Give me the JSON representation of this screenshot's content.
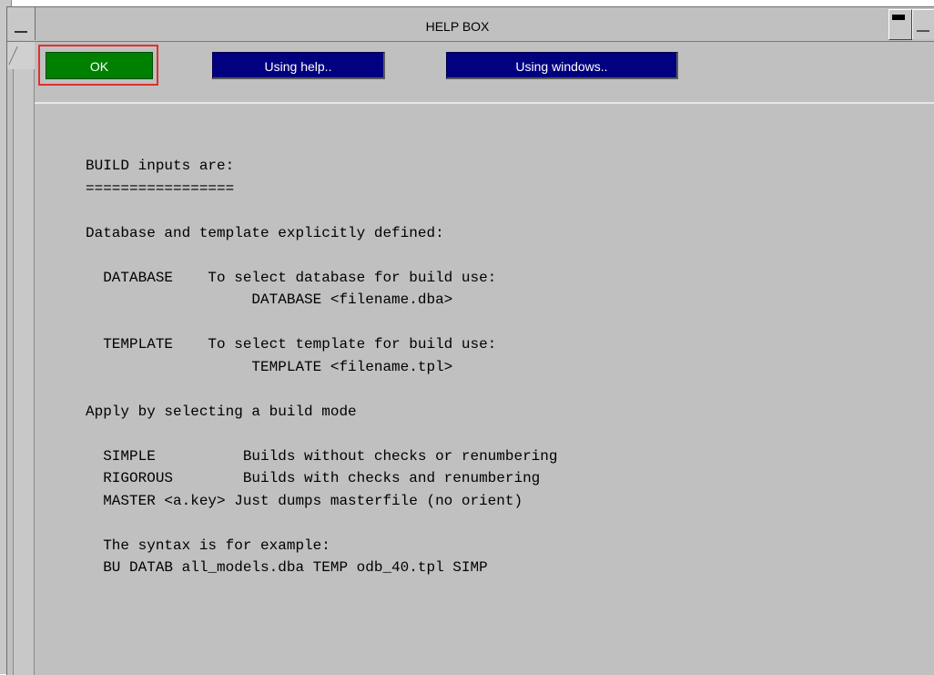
{
  "window": {
    "title": "HELP BOX"
  },
  "toolbar": {
    "ok_label": "OK",
    "using_help_label": "Using help..",
    "using_windows_label": "Using windows.."
  },
  "colors": {
    "ok_button": "#008000",
    "blue_button": "#000080",
    "highlight": "#e03030",
    "background": "#c0c0c0"
  },
  "help": {
    "lines": [
      "BUILD inputs are:",
      "=================",
      "",
      "Database and template explicitly defined:",
      "",
      "  DATABASE    To select database for build use:",
      "                   DATABASE <filename.dba>",
      "",
      "  TEMPLATE    To select template for build use:",
      "                   TEMPLATE <filename.tpl>",
      "",
      "Apply by selecting a build mode",
      "",
      "  SIMPLE          Builds without checks or renumbering",
      "  RIGOROUS        Builds with checks and renumbering",
      "  MASTER <a.key> Just dumps masterfile (no orient)",
      "",
      "  The syntax is for example:",
      "  BU DATAB all_models.dba TEMP odb_40.tpl SIMP"
    ]
  }
}
